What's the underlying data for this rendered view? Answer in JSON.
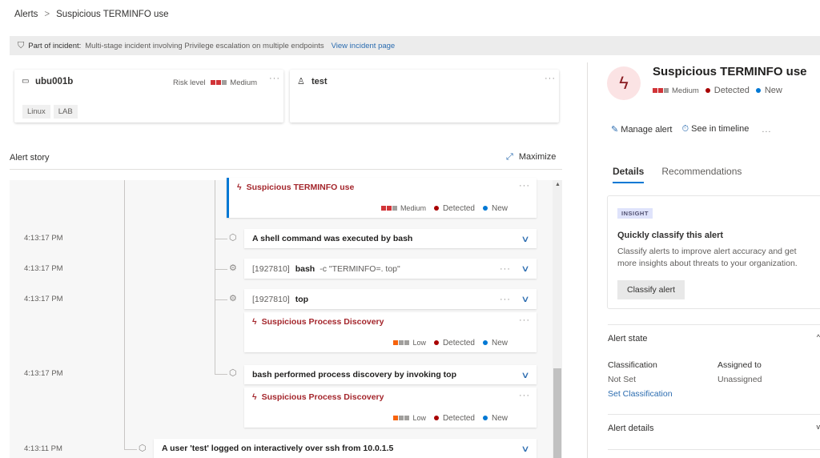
{
  "breadcrumb": {
    "root": "Alerts",
    "separator": ">",
    "current": "Suspicious TERMINFO use"
  },
  "banner": {
    "label": "Part of incident:",
    "text": "Multi-stage incident involving Privilege escalation on multiple endpoints",
    "link": "View incident page"
  },
  "device": {
    "name": "ubu001b",
    "risk_label": "Risk level",
    "risk": "Medium",
    "tags": [
      "Linux",
      "LAB"
    ]
  },
  "user": {
    "name": "test"
  },
  "story": {
    "title": "Alert story",
    "maximize": "Maximize",
    "items": [
      {
        "title": "Suspicious TERMINFO use",
        "severity": "Medium",
        "detection": "Detected",
        "status": "New"
      },
      {
        "time": "4:13:17 PM",
        "text": "A shell command was executed by bash"
      },
      {
        "time": "4:13:17 PM",
        "pid": "[1927810]",
        "proc": "bash",
        "args": "-c \"TERMINFO=. top\""
      },
      {
        "time": "4:13:17 PM",
        "pid": "[1927810]",
        "proc": "top"
      },
      {
        "title": "Suspicious Process Discovery",
        "severity": "Low",
        "detection": "Detected",
        "status": "New"
      },
      {
        "time": "4:13:17 PM",
        "text": "bash performed process discovery by invoking top"
      },
      {
        "title": "Suspicious Process Discovery",
        "severity": "Low",
        "detection": "Detected",
        "status": "New"
      },
      {
        "time": "4:13:11 PM",
        "text": "A user 'test' logged on interactively over ssh from 10.0.1.5"
      }
    ]
  },
  "panel": {
    "title": "Suspicious TERMINFO use",
    "severity": "Medium",
    "detection": "Detected",
    "status": "New",
    "actions": {
      "manage": "Manage alert",
      "timeline": "See in timeline",
      "more": "..."
    },
    "tabs": [
      "Details",
      "Recommendations"
    ],
    "insight": {
      "badge": "INSIGHT",
      "title": "Quickly classify this alert",
      "text": "Classify alerts to improve alert accuracy and get more insights about threats to your organization.",
      "button": "Classify alert"
    },
    "alert_state": {
      "title": "Alert state",
      "classification_label": "Classification",
      "classification": "Not Set",
      "set_link": "Set Classification",
      "assigned_label": "Assigned to",
      "assigned": "Unassigned"
    },
    "alert_details": {
      "title": "Alert details"
    }
  },
  "colors": {
    "accent": "#0078d4",
    "alert_red": "#a4262c",
    "sev_red": "#d13438",
    "sev_orange": "#f7630c",
    "detected": "#a80000"
  }
}
